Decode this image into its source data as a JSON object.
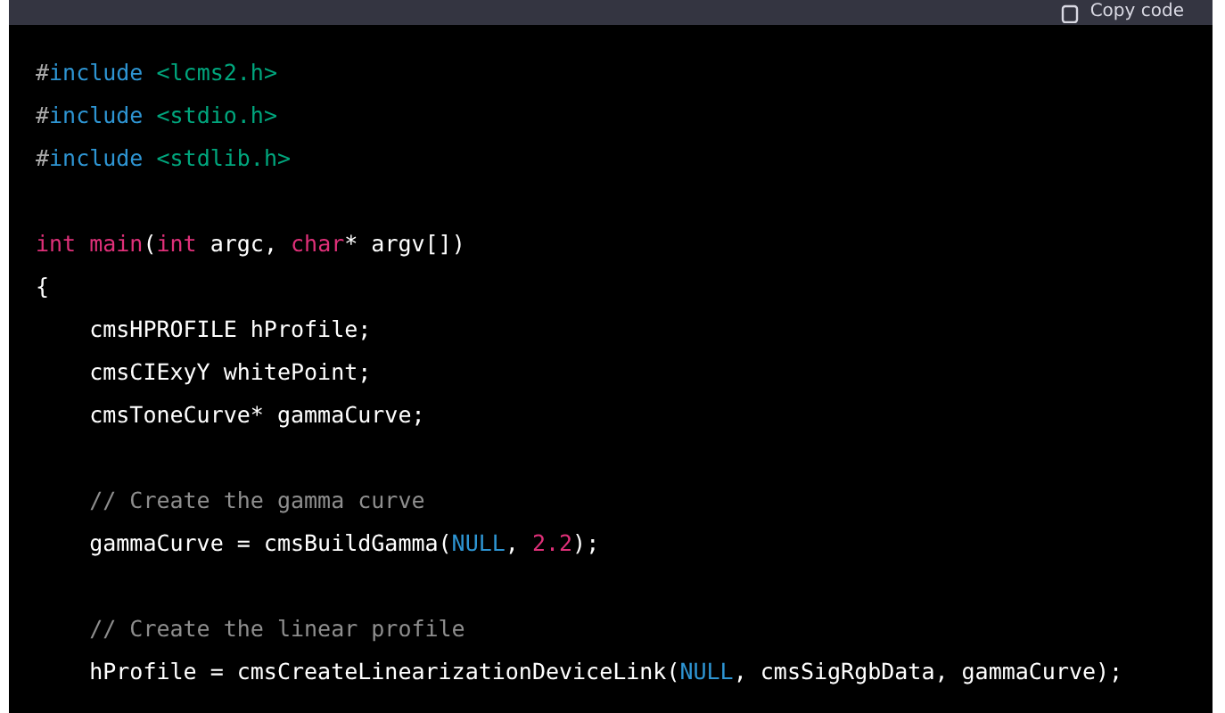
{
  "header": {
    "copy_button": "Copy code"
  },
  "code_lines": [
    {
      "kind": "code",
      "tokens": [
        {
          "kind": "punct",
          "text": "#"
        },
        {
          "kind": "keyword",
          "text": "include"
        },
        {
          "kind": "string",
          "text": " <lcms2.h>"
        }
      ]
    },
    {
      "kind": "code",
      "tokens": [
        {
          "kind": "punct",
          "text": "#"
        },
        {
          "kind": "keyword",
          "text": "include"
        },
        {
          "kind": "string",
          "text": " <stdio.h>"
        }
      ]
    },
    {
      "kind": "code",
      "tokens": [
        {
          "kind": "punct",
          "text": "#"
        },
        {
          "kind": "keyword",
          "text": "include"
        },
        {
          "kind": "string",
          "text": " <stdlib.h>"
        }
      ]
    },
    {
      "kind": "blank"
    },
    {
      "kind": "code",
      "tokens": [
        {
          "kind": "type",
          "text": "int main"
        },
        {
          "kind": "plain",
          "text": "("
        },
        {
          "kind": "type",
          "text": "int"
        },
        {
          "kind": "plain",
          "text": " argc, "
        },
        {
          "kind": "type",
          "text": "char"
        },
        {
          "kind": "plain",
          "text": "* argv[])"
        }
      ]
    },
    {
      "kind": "code",
      "tokens": [
        {
          "kind": "plain",
          "text": "{"
        }
      ]
    },
    {
      "kind": "code",
      "tokens": [
        {
          "kind": "plain",
          "text": "    cmsHPROFILE hProfile;"
        }
      ]
    },
    {
      "kind": "code",
      "tokens": [
        {
          "kind": "plain",
          "text": "    cmsCIExyY whitePoint;"
        }
      ]
    },
    {
      "kind": "code",
      "tokens": [
        {
          "kind": "plain",
          "text": "    cmsToneCurve* gammaCurve;"
        }
      ]
    },
    {
      "kind": "blank"
    },
    {
      "kind": "code",
      "tokens": [
        {
          "kind": "comment",
          "text": "    // Create the gamma curve"
        }
      ]
    },
    {
      "kind": "code",
      "tokens": [
        {
          "kind": "plain",
          "text": "    gammaCurve = cmsBuildGamma("
        },
        {
          "kind": "keyword",
          "text": "NULL"
        },
        {
          "kind": "plain",
          "text": ", "
        },
        {
          "kind": "number",
          "text": "2.2"
        },
        {
          "kind": "plain",
          "text": ");"
        }
      ]
    },
    {
      "kind": "blank"
    },
    {
      "kind": "code",
      "tokens": [
        {
          "kind": "comment",
          "text": "    // Create the linear profile"
        }
      ]
    },
    {
      "kind": "code",
      "tokens": [
        {
          "kind": "plain",
          "text": "    hProfile = cmsCreateLinearizationDeviceLink("
        },
        {
          "kind": "keyword",
          "text": "NULL"
        },
        {
          "kind": "plain",
          "text": ", cmsSigRgbData, gammaCurve);"
        }
      ]
    }
  ]
}
